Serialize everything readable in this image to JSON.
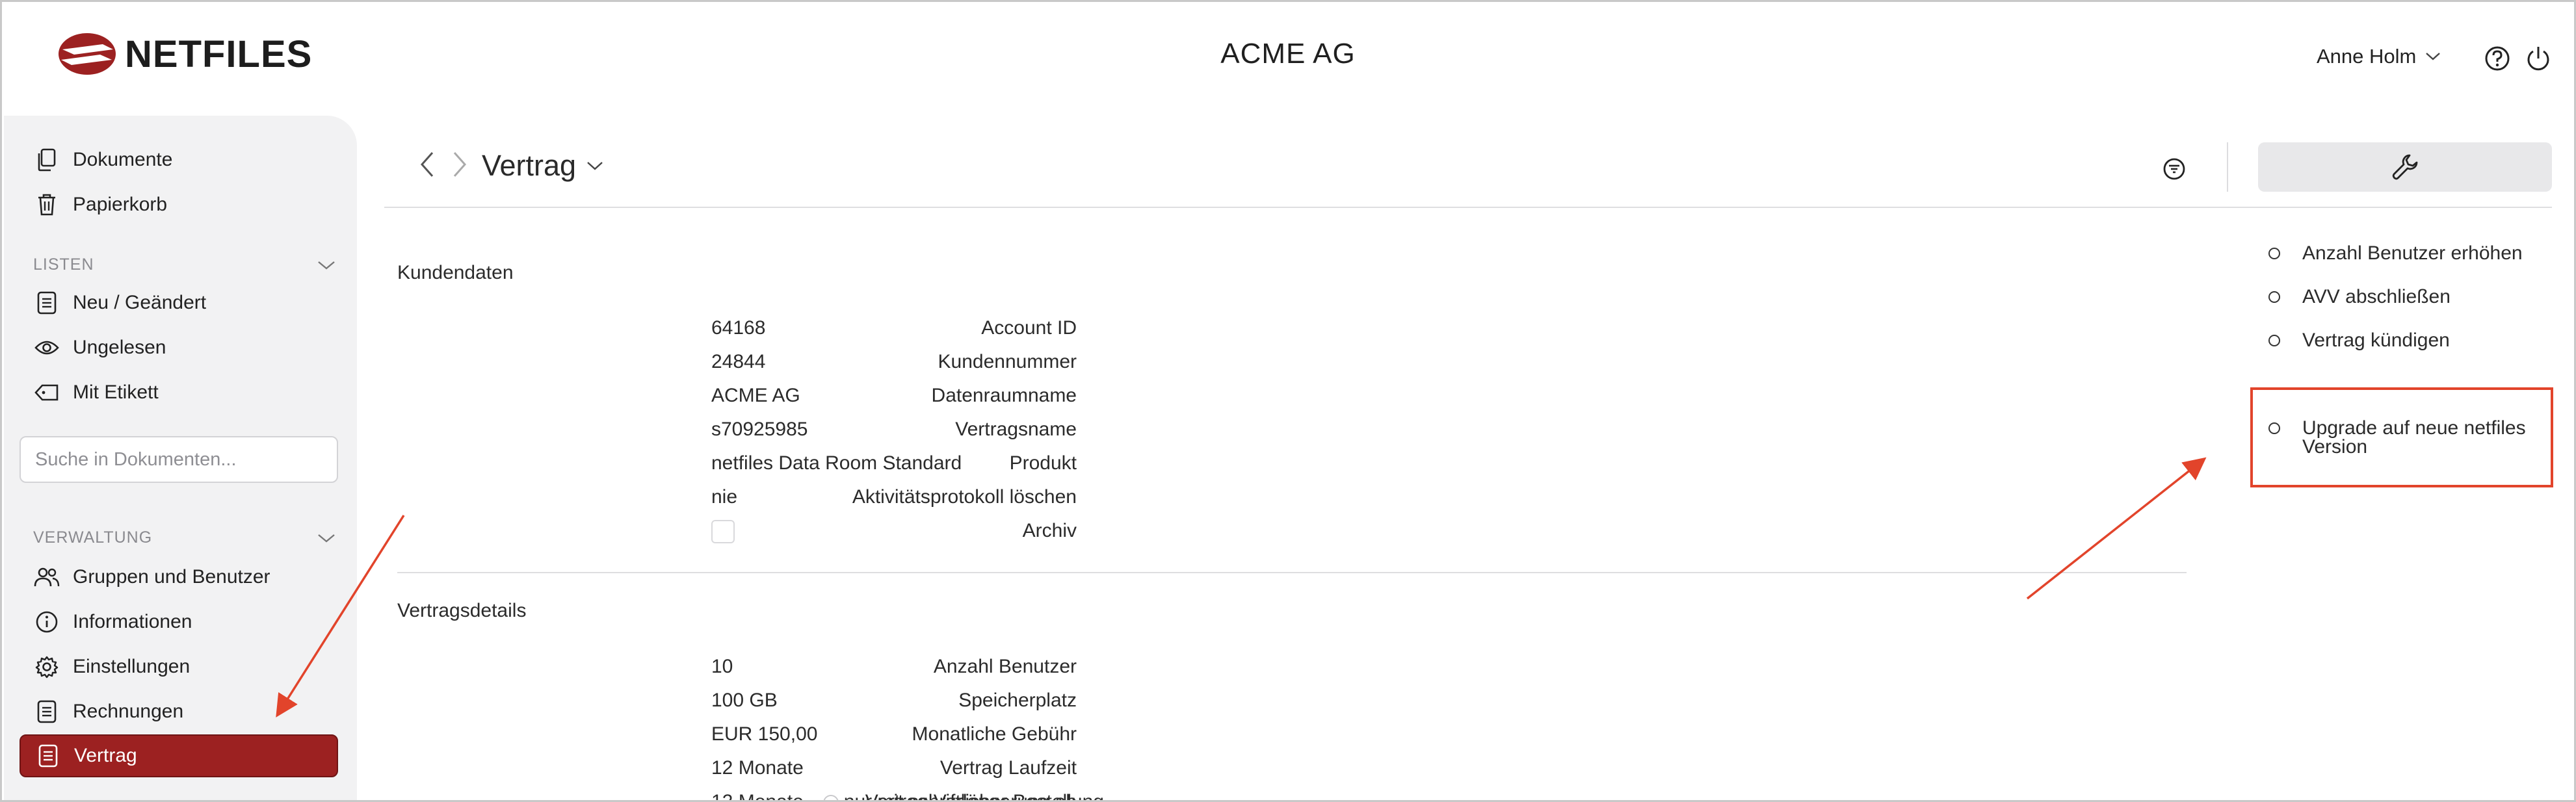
{
  "app": {
    "logo_text": "NETFILES",
    "company": "ACME AG",
    "user_name": "Anne Holm"
  },
  "colors": {
    "brand": "#9c2121",
    "annotation": "#e2442b"
  },
  "sidebar": {
    "top_items": [
      {
        "label": "Dokumente",
        "icon": "documents-icon"
      },
      {
        "label": "Papierkorb",
        "icon": "trash-icon"
      }
    ],
    "lists_label": "LISTEN",
    "list_items": [
      {
        "label": "Neu / Geändert",
        "icon": "list-icon"
      },
      {
        "label": "Ungelesen",
        "icon": "eye-icon"
      },
      {
        "label": "Mit Etikett",
        "icon": "tag-icon"
      }
    ],
    "search_placeholder": "Suche in Dokumenten...",
    "admin_label": "VERWALTUNG",
    "admin_items": [
      {
        "label": "Gruppen und Benutzer",
        "icon": "users-icon"
      },
      {
        "label": "Informationen",
        "icon": "info-icon"
      },
      {
        "label": "Einstellungen",
        "icon": "gear-icon"
      },
      {
        "label": "Rechnungen",
        "icon": "invoice-icon"
      },
      {
        "label": "Vertrag",
        "icon": "contract-icon",
        "active": true
      }
    ]
  },
  "main": {
    "title": "Vertrag",
    "customer_section": "Kundendaten",
    "customer_fields": [
      {
        "label": "Account ID",
        "value": "64168"
      },
      {
        "label": "Kundennummer",
        "value": "24844"
      },
      {
        "label": "Datenraumname",
        "value": "ACME AG"
      },
      {
        "label": "Vertragsname",
        "value": "s70925985"
      },
      {
        "label": "Produkt",
        "value": "netfiles Data Room Standard"
      },
      {
        "label": "Aktivitätsprotokoll löschen",
        "value": "nie"
      },
      {
        "label": "Archiv",
        "value": ""
      }
    ],
    "contract_section": "Vertragsdetails",
    "contract_fields": [
      {
        "label": "Anzahl Benutzer",
        "value": "10"
      },
      {
        "label": "Speicherplatz",
        "value": "100 GB"
      },
      {
        "label": "Monatliche Gebühr",
        "value": "EUR 150,00"
      },
      {
        "label": "Vertrag Laufzeit",
        "value": "12 Monate"
      },
      {
        "label": "Vertrag Verlängerung ab",
        "value": "12 Monate",
        "extra": "nur mit schriftlicher Bestellung"
      }
    ]
  },
  "actions": [
    {
      "label": "Anzahl Benutzer erhöhen"
    },
    {
      "label": "AVV abschließen"
    },
    {
      "label": "Vertrag kündigen"
    },
    {
      "label": "Upgrade auf neue netfiles Version"
    }
  ]
}
